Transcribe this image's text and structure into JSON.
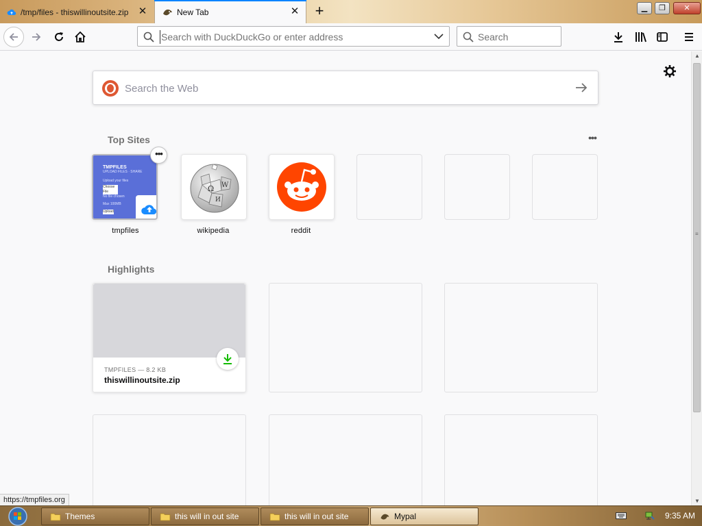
{
  "browser": {
    "tabs": [
      {
        "label": "/tmp/files - thiswillinoutsite.zip",
        "favicon": "cloud-upload-icon",
        "active": false
      },
      {
        "label": "New Tab",
        "favicon": "mypal-icon",
        "active": true
      }
    ],
    "urlbar": {
      "placeholder": "Search with DuckDuckGo or enter address",
      "value": ""
    },
    "searchbar": {
      "placeholder": "Search"
    },
    "accent_color": "#0a84ff"
  },
  "newtab": {
    "websearch": {
      "placeholder": "Search the Web",
      "engine_icon": "duckduckgo-icon"
    },
    "top_sites": {
      "title": "Top Sites",
      "more_label": "•••",
      "tiles": [
        {
          "label": "tmpfiles",
          "preview_title": "TMPFILES",
          "preview_lines": [
            "UPLOAD FILES · SHARE",
            "Upload your files",
            "Choose File",
            "No file chosen",
            "Max 100MB",
            "Upload"
          ]
        },
        {
          "label": "wikipedia",
          "icon": "wikipedia-globe-icon"
        },
        {
          "label": "reddit",
          "icon": "reddit-alien-icon",
          "color": "#ff4500"
        },
        {
          "label": ""
        },
        {
          "label": ""
        },
        {
          "label": ""
        }
      ],
      "tile_menu_label": "•••"
    },
    "highlights": {
      "title": "Highlights",
      "cards": [
        {
          "source": "TMPFILES — 8.2 KB",
          "title": "thiswillinoutsite.zip",
          "badge": "download-icon",
          "badge_color": "#12bc00"
        }
      ]
    }
  },
  "status_url": "https://tmpfiles.org",
  "taskbar": {
    "items": [
      {
        "label": "Themes",
        "icon": "folder-icon",
        "active": false
      },
      {
        "label": "this will in out site",
        "icon": "folder-icon",
        "active": false
      },
      {
        "label": "this will in out site",
        "icon": "folder-icon",
        "active": false
      },
      {
        "label": "Mypal",
        "icon": "mypal-icon",
        "active": true
      }
    ],
    "clock": "9:35 AM"
  }
}
